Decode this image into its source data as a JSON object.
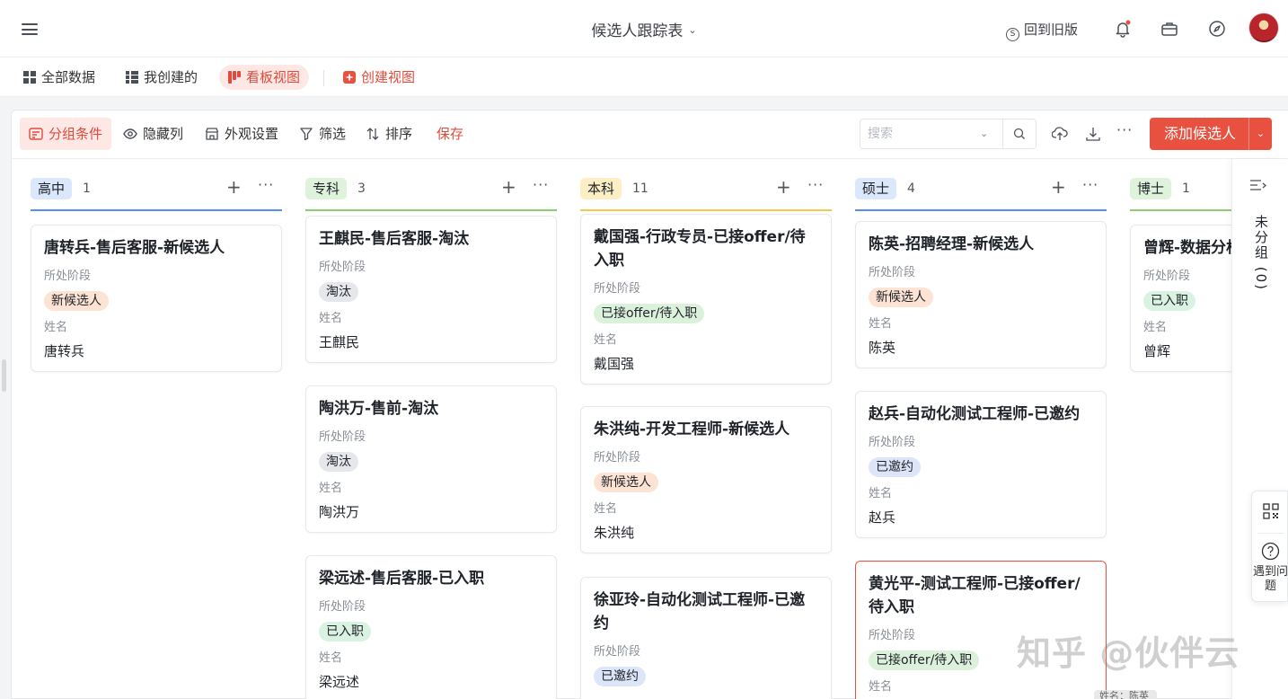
{
  "header": {
    "title": "候选人跟踪表",
    "revert_label": "回到旧版"
  },
  "views": {
    "tabs": [
      {
        "label": "全部数据"
      },
      {
        "label": "我创建的"
      },
      {
        "label": "看板视图"
      }
    ],
    "create_label": "创建视图"
  },
  "toolbar": {
    "group_label": "分组条件",
    "hide_label": "隐藏列",
    "appearance_label": "外观设置",
    "filter_label": "筛选",
    "sort_label": "排序",
    "save_label": "保存",
    "search_placeholder": "搜索",
    "add_label": "添加候选人"
  },
  "fields": {
    "stage_label": "所处阶段",
    "name_label": "姓名"
  },
  "columns": [
    {
      "tag": "高中",
      "count": "1",
      "tag_color": "#dbe7fb",
      "line_color": "#5a8df0",
      "cards": [
        {
          "title": "唐转兵-售后客服-新候选人",
          "stage": "新候选人",
          "stage_color": "#fde3d3",
          "name": "唐转兵"
        }
      ]
    },
    {
      "tag": "专科",
      "count": "3",
      "tag_color": "#dff3dc",
      "line_color": "#8fce6f",
      "cards": [
        {
          "title": "王麒民-售后客服-淘汰",
          "stage": "淘汰",
          "stage_color": "#e5e7eb",
          "name": "王麒民"
        },
        {
          "title": "陶洪万-售前-淘汰",
          "stage": "淘汰",
          "stage_color": "#e5e7eb",
          "name": "陶洪万"
        },
        {
          "title": "梁远述-售后客服-已入职",
          "stage": "已入职",
          "stage_color": "#d9f2e1",
          "name": "梁远述"
        }
      ]
    },
    {
      "tag": "本科",
      "count": "11",
      "tag_color": "#fcefc5",
      "line_color": "#f2c94c",
      "cards": [
        {
          "title": "戴国强-行政专员-已接offer/待入职",
          "stage": "已接offer/待入职",
          "stage_color": "#dcf1dc",
          "name": "戴国强"
        },
        {
          "title": "朱洪纯-开发工程师-新候选人",
          "stage": "新候选人",
          "stage_color": "#fde3d3",
          "name": "朱洪纯"
        },
        {
          "title": "徐亚玲-自动化测试工程师-已邀约",
          "stage": "已邀约",
          "stage_color": "#dde5f8",
          "name": ""
        }
      ]
    },
    {
      "tag": "硕士",
      "count": "4",
      "tag_color": "#dbe7fb",
      "line_color": "#5a8df0",
      "cards": [
        {
          "title": "陈英-招聘经理-新候选人",
          "stage": "新候选人",
          "stage_color": "#fde3d3",
          "name": "陈英"
        },
        {
          "title": "赵兵-自动化测试工程师-已邀约",
          "stage": "已邀约",
          "stage_color": "#dde5f8",
          "name": "赵兵"
        },
        {
          "title": "黄光平-测试工程师-已接offer/待入职",
          "stage": "已接offer/待入职",
          "stage_color": "#dcf1dc",
          "name": ""
        }
      ]
    },
    {
      "tag": "博士",
      "count": "1",
      "tag_color": "#dff3dc",
      "line_color": "#8fce6f",
      "cards": [
        {
          "title": "曾辉-数据分析",
          "stage": "已入职",
          "stage_color": "#d9f2e1",
          "name": "曾辉"
        }
      ]
    }
  ],
  "ungrouped_label": "未分组 (0)",
  "help_label": "遇到问题",
  "watermark": "知乎 @伙伴云",
  "tooltip": "姓名：陈英"
}
